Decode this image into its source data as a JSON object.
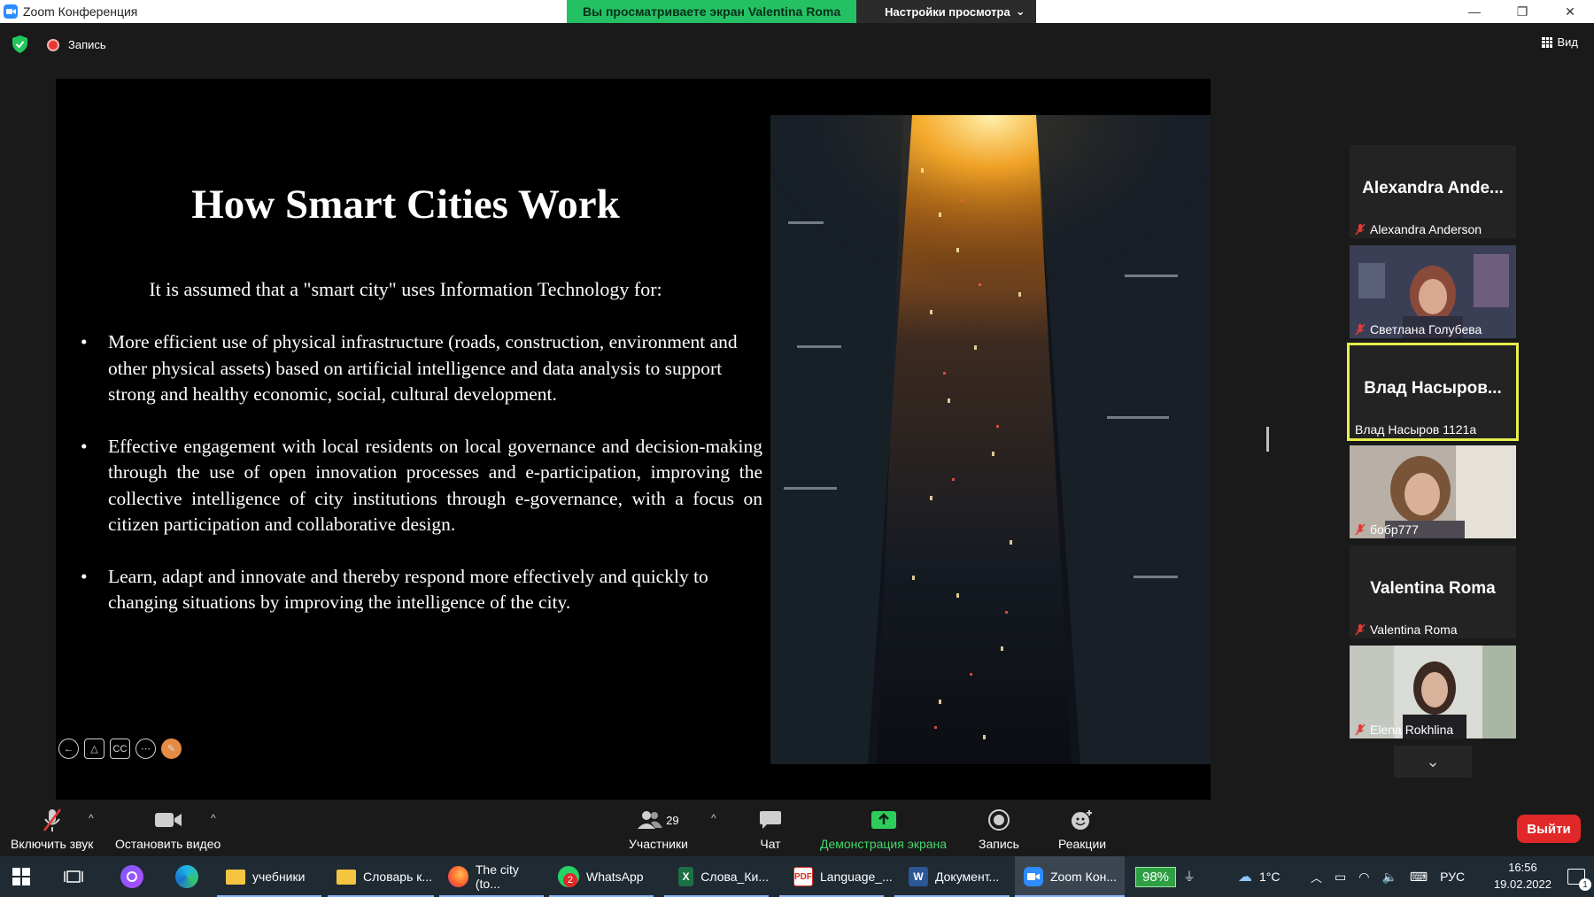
{
  "window": {
    "title": "Zoom Конференция",
    "share_banner": "Вы просматриваете экран Valentina Roma",
    "view_options": "Настройки просмотра",
    "controls": [
      "—",
      "❐",
      "✕"
    ]
  },
  "meeting_bar": {
    "recording_label": "Запись",
    "view_label": "Вид"
  },
  "slide": {
    "title": "How Smart Cities Work",
    "intro": "It is assumed that a \"smart city\" uses Information Technology for:",
    "bullets": [
      "More efficient use of physical infrastructure (roads, construction, environment and other physical assets) based on artificial intelligence and data analysis to support strong and healthy economic, social, cultural development.",
      "Effective engagement with local residents on local governance and decision-making through the use of open innovation processes and e-participation, improving the collective intelligence of city institutions through e-governance, with a focus on citizen participation and collaborative design.",
      "Learn, adapt and innovate and thereby respond more effectively and quickly to changing situations by improving the intelligence of the city."
    ],
    "tools": [
      "←",
      "△",
      "CC",
      "⋯",
      "✎"
    ]
  },
  "participants": [
    {
      "display": "Alexandra Ande...",
      "name": "Alexandra Anderson",
      "video": false,
      "speaking": false,
      "muted": true
    },
    {
      "display": "",
      "name": "Светлана Голубева",
      "video": true,
      "speaking": false,
      "muted": true
    },
    {
      "display": "Влад Насыров...",
      "name": "Влад Насыров 1121а",
      "video": false,
      "speaking": true,
      "muted": false
    },
    {
      "display": "",
      "name": "бобр777",
      "video": true,
      "speaking": false,
      "muted": true
    },
    {
      "display": "Valentina Roma",
      "name": "Valentina Roma",
      "video": false,
      "speaking": false,
      "muted": true
    },
    {
      "display": "",
      "name": "Elena Rokhlina",
      "video": true,
      "speaking": false,
      "muted": true
    }
  ],
  "toolbar": {
    "unmute": "Включить звук",
    "stop_video": "Остановить видео",
    "participants": "Участники",
    "participant_count": "29",
    "chat": "Чат",
    "share_screen": "Демонстрация экрана",
    "record": "Запись",
    "reactions": "Реакции",
    "leave": "Выйти"
  },
  "taskbar": {
    "items": [
      {
        "label": "учебники"
      },
      {
        "label": "Словарь к..."
      },
      {
        "label": "The city (to..."
      },
      {
        "label": "WhatsApp",
        "badge": "2"
      },
      {
        "label": "Слова_Ки..."
      },
      {
        "label": "Language_..."
      },
      {
        "label": "Документ..."
      },
      {
        "label": "Zoom Кон..."
      }
    ],
    "battery": "98%",
    "temperature": "1°C",
    "language": "РУС",
    "time": "16:56",
    "date": "19.02.2022",
    "notifications": "1"
  },
  "colors": {
    "share_green": "#24c164",
    "speaking_outline": "#e8ee4b",
    "leave_red": "#e02828",
    "share_label_green": "#44d76d"
  }
}
